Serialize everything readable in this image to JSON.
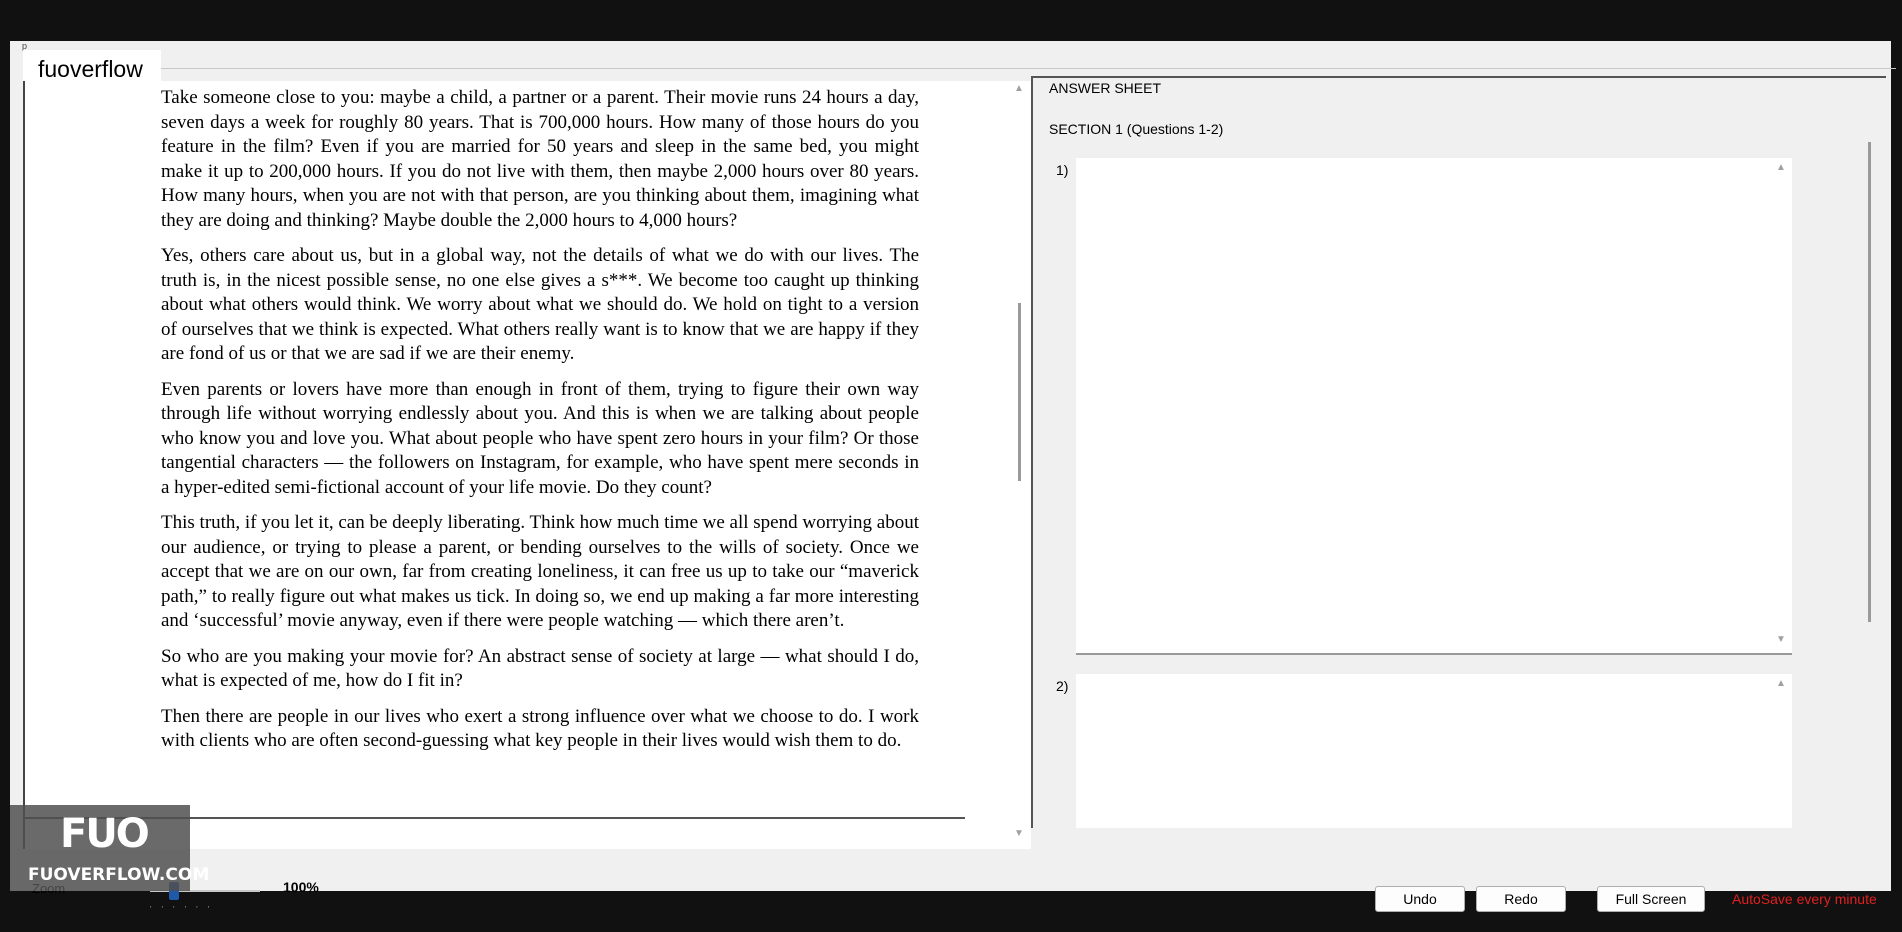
{
  "window": {
    "title": "fuoverflow",
    "corner_label": "p"
  },
  "reading": {
    "paragraphs": [
      "Take someone close to you: maybe a child, a partner or a parent. Their movie runs 24 hours a day, seven days a week for roughly 80 years. That is 700,000 hours. How many of those hours do you feature in the film? Even if you are married for 50 years and sleep in the same bed, you might make it up to 200,000 hours. If you do not live with them, then maybe 2,000 hours over 80 years. How many hours, when you are not with that person, are you thinking about them, imagining what they are doing and thinking? Maybe double the 2,000 hours to 4,000 hours?",
      "Yes, others care about us, but in a global way, not the details of what we do with our lives. The truth is, in the nicest possible sense, no one else gives a s***. We become too caught up thinking about what others would think. We worry about what we should do. We hold on tight to a version of ourselves that we think is expected. What others really want is to know that we are happy if they are fond of us or that we are sad if we are their enemy.",
      "Even parents or lovers have more than enough in front of them, trying to figure their own way through life without worrying endlessly about you. And this is when we are talking about people who know you and love you. What about people who have spent zero hours in your film? Or those tangential characters — the followers on Instagram, for example, who have spent mere seconds in a hyper-edited semi-fictional account of your life movie. Do they count?",
      "This truth, if you let it, can be deeply liberating. Think how much time we all spend worrying about our audience, or trying to please a parent, or bending ourselves to the wills of society. Once we accept that we are on our own, far from creating loneliness, it can free us up to take our “maverick path,” to really figure out what makes us tick. In doing so, we end up making a far more interesting and ‘successful’ movie anyway, even if there were people watching — which there aren’t.",
      "So who are you making your movie for? An abstract sense of society at large — what should I do, what is expected of me, how do I fit in?",
      "Then there are people in our lives who exert a strong influence over what we choose to do. I work with clients who are often second-guessing what key people in their lives would wish them to do."
    ]
  },
  "answer_sheet": {
    "title": "ANSWER SHEET",
    "section": "SECTION 1 (Questions 1-2)",
    "questions": [
      {
        "number": "1)",
        "answer": ""
      },
      {
        "number": "2)",
        "answer": ""
      }
    ]
  },
  "bottom_bar": {
    "zoom_label": "Zoom",
    "zoom_value": "100%",
    "zoom_level_percent": 100,
    "undo_label": "Undo",
    "redo_label": "Redo",
    "fullscreen_label": "Full Screen",
    "autosave_text": "AutoSave every minute"
  },
  "watermark": {
    "logo": "FUO",
    "text": "FUOVERFLOW.COM"
  },
  "colors": {
    "autosave": "#e02020",
    "zoom_thumb": "#1e5aa8",
    "background": "#111111"
  }
}
